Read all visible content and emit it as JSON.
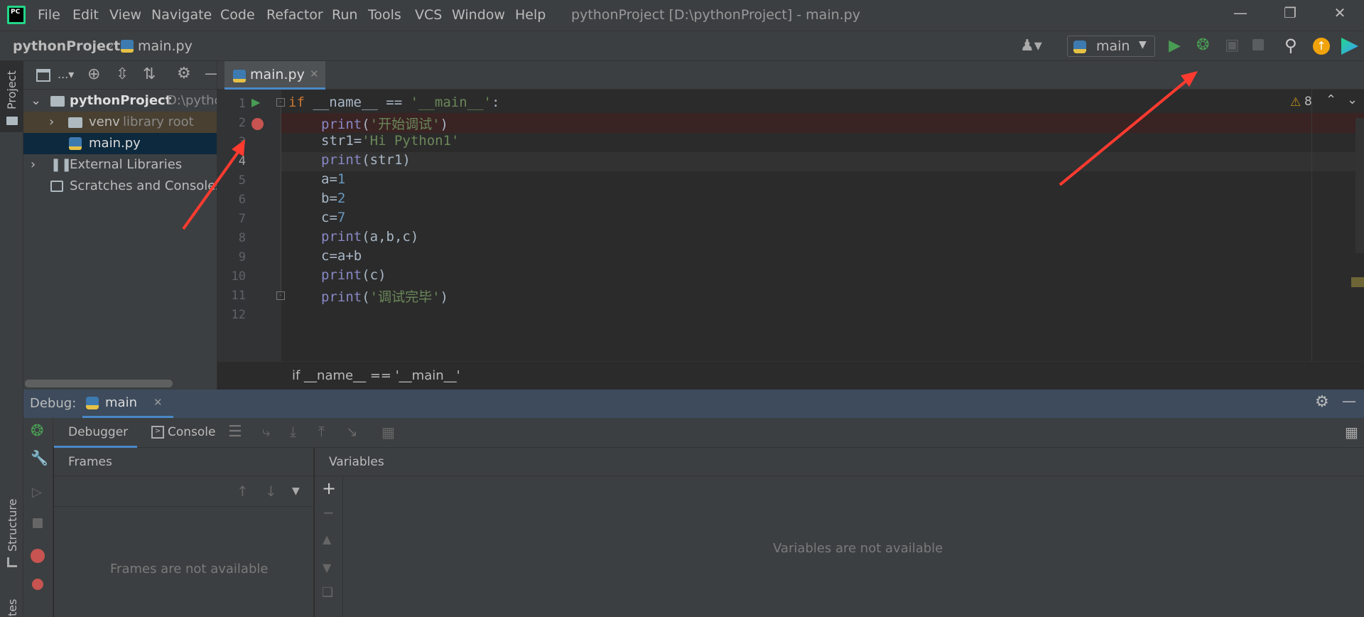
{
  "app": {
    "logo": "PC",
    "title": "pythonProject [D:\\pythonProject] - main.py",
    "menu": [
      "File",
      "Edit",
      "View",
      "Navigate",
      "Code",
      "Refactor",
      "Run",
      "Tools",
      "VCS",
      "Window",
      "Help"
    ]
  },
  "navbar": {
    "project": "pythonProject",
    "file": "main.py",
    "run_config": "main"
  },
  "left_strip": {
    "project_tab": "Project",
    "structure_tab": "Structure",
    "favorites_tab": "tes"
  },
  "project_panel": {
    "root_name": "pythonProject",
    "root_path": "D:\\pytho",
    "venv_name": "venv",
    "venv_tag": "library root",
    "file_name": "main.py",
    "external": "External Libraries",
    "scratches": "Scratches and Consoles",
    "toolbar_dots": "..."
  },
  "editor": {
    "tab": "main.py",
    "warnings": "8",
    "breadcrumb": "if __name__ == '__main__'",
    "lines": [
      "1",
      "2",
      "3",
      "4",
      "5",
      "6",
      "7",
      "8",
      "9",
      "10",
      "11",
      "12"
    ]
  },
  "debug": {
    "label": "Debug:",
    "session": "main",
    "tab_debugger": "Debugger",
    "tab_console": "Console",
    "frames_title": "Frames",
    "frames_empty": "Frames are not available",
    "vars_title": "Variables",
    "vars_empty": "Variables are not available"
  },
  "colors": {
    "accent_green": "#499c54",
    "breakpoint": "#c75450",
    "arrow": "#ff3b30"
  }
}
